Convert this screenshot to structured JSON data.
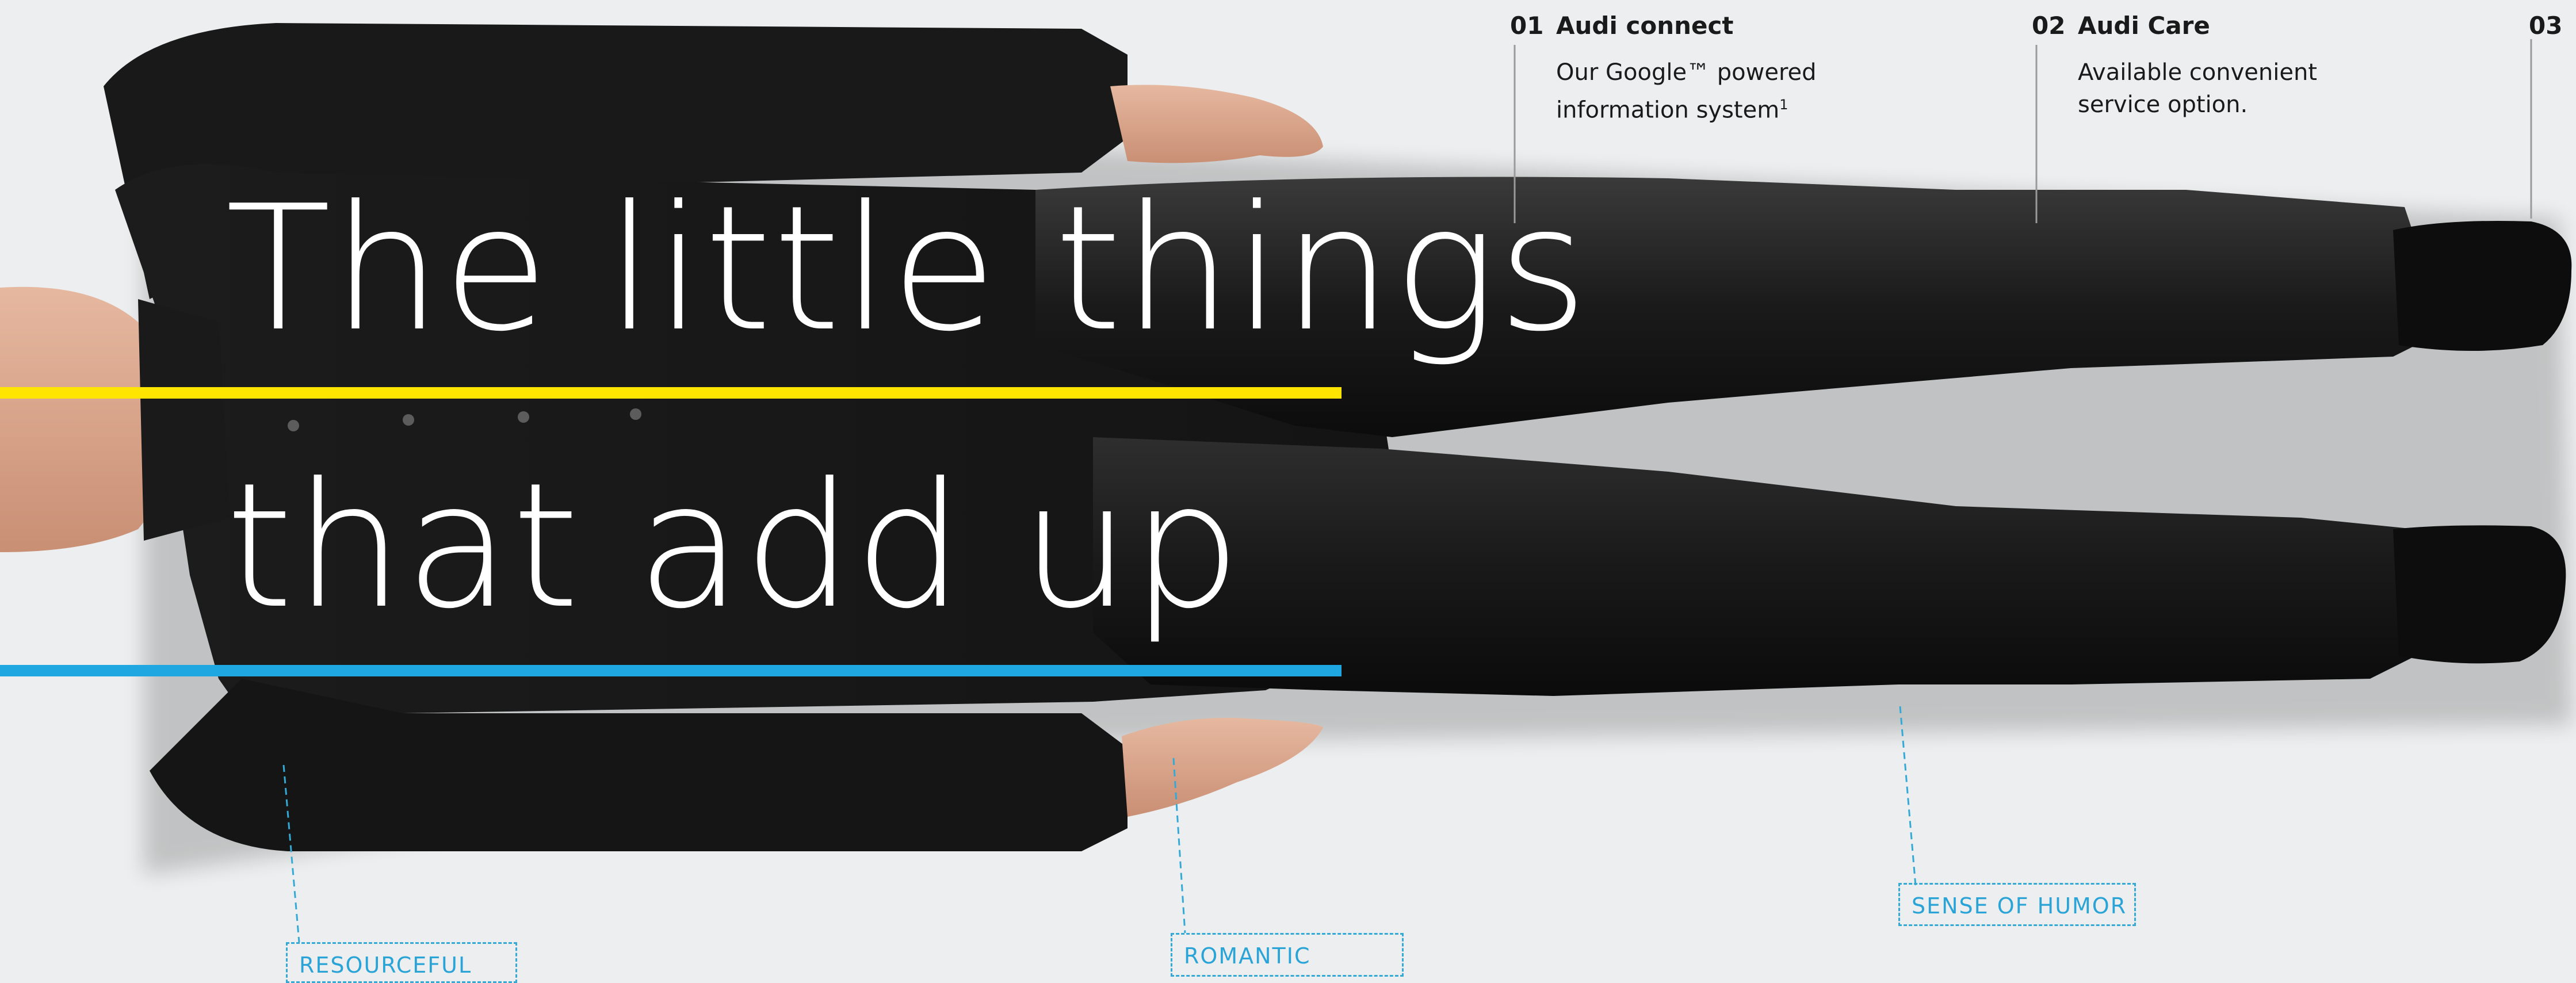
{
  "headline": {
    "line1": "The little things",
    "line2": "that add up"
  },
  "colors": {
    "stripe_top": "#ffe500",
    "stripe_bottom": "#1ea7e1",
    "callout": "#35a9d6",
    "background": "#eceeef"
  },
  "features": [
    {
      "number": "01",
      "title": "Audi connect",
      "desc_line1": "Our Google™ powered",
      "desc_line2": "information system",
      "footnote": "1"
    },
    {
      "number": "02",
      "title": "Audi Care",
      "desc_line1": "Available convenient",
      "desc_line2": "service option."
    },
    {
      "number": "03"
    }
  ],
  "callouts": {
    "resourceful": "RESOURCEFUL",
    "romantic": "ROMANTIC",
    "sense_of_humor": "SENSE OF HUMOR"
  }
}
